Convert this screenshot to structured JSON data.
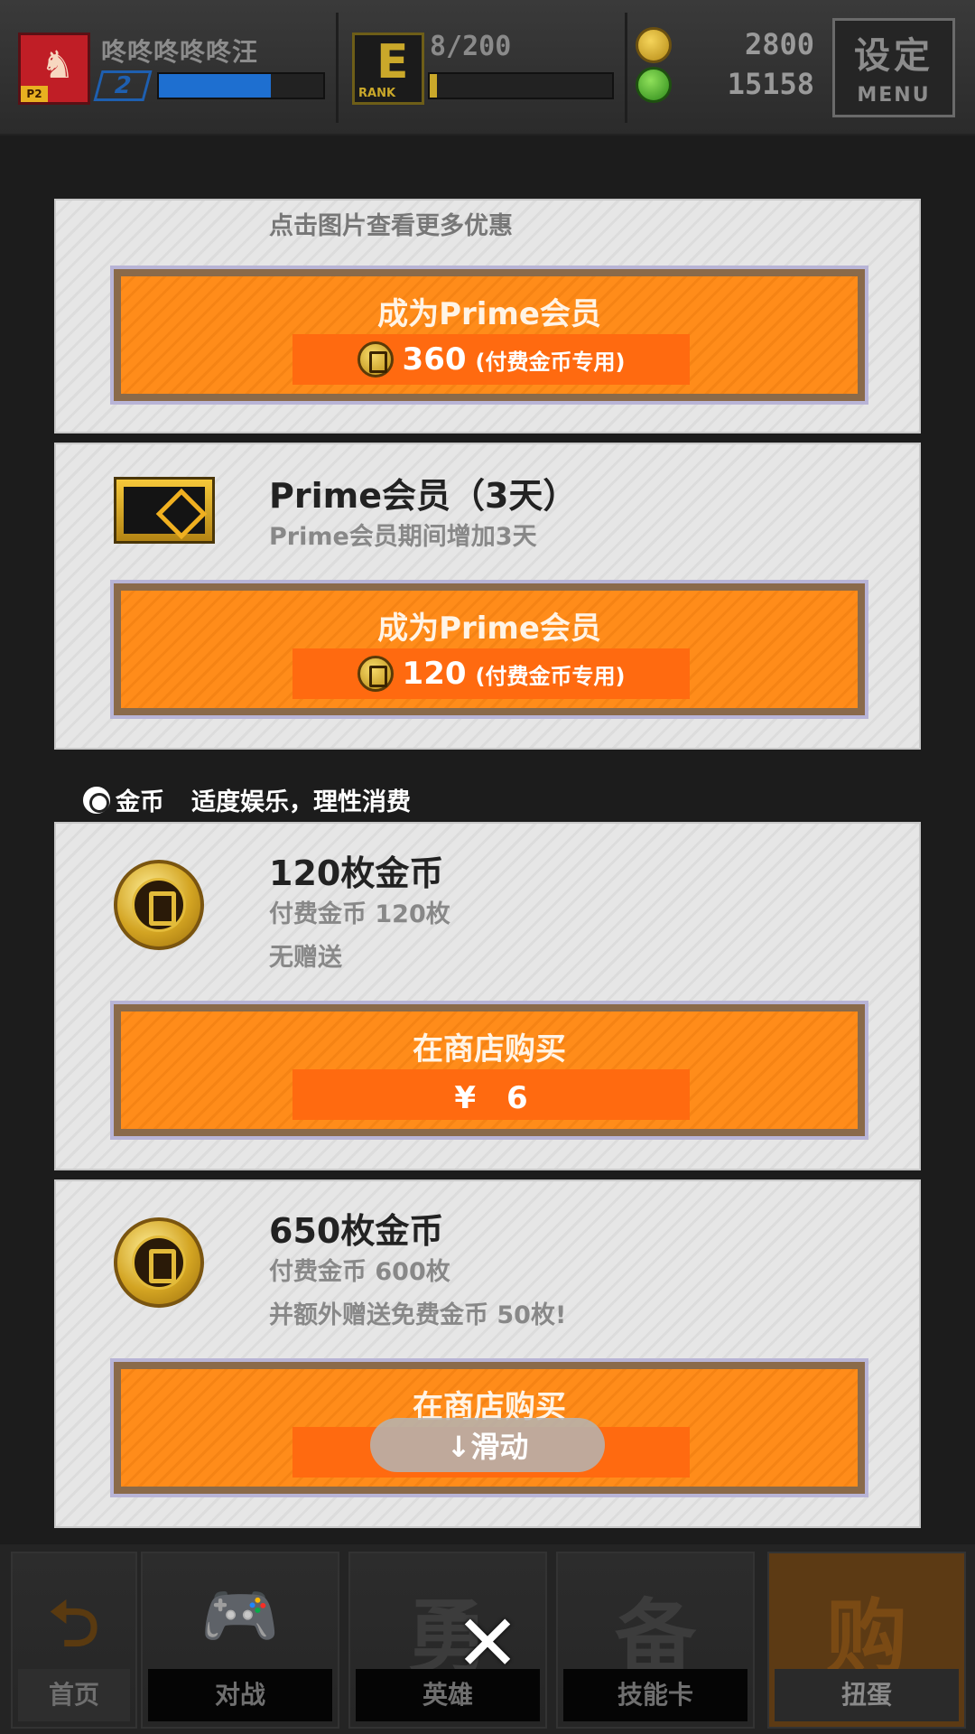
{
  "header": {
    "player_name": "咚咚咚咚咚汪",
    "player_level": "2",
    "avatar_tag": "P2",
    "rank_progress": "8/200",
    "rank_label": "RANK",
    "exp_fill": 0.68,
    "rank_fill": 0.04,
    "gold_coins": "2800",
    "green_coins": "15158",
    "menu_cn": "设定",
    "menu_en": "MENU"
  },
  "offers": [
    {
      "hint": "点击图片查看更多优惠",
      "button_label": "成为Prime会员",
      "price": "360",
      "price_note": "(付费金币专用)"
    },
    {
      "title": "Prime会员（3天）",
      "desc": "Prime会员期间增加3天",
      "icon": "prime-ticket-icon",
      "button_label": "成为Prime会员",
      "price": "120",
      "price_note": "(付费金币专用)"
    }
  ],
  "coin_section": {
    "label": "金币",
    "slogan": "适度娱乐，理性消费"
  },
  "coin_packs": [
    {
      "title": "120枚金币",
      "line1": "付费金币 120枚",
      "line2": "无赠送",
      "button_label": "在商店购买",
      "price": "¥　6"
    },
    {
      "title": "650枚金币",
      "line1": "付费金币 600枚",
      "line2": "并额外赠送免费金币 50枚!",
      "button_label": "在商店购买",
      "price": ""
    }
  ],
  "swipe_hint": "↓滑动",
  "nav": [
    {
      "label": "首页",
      "icon": "back-arrow-icon",
      "glyph": "⮌"
    },
    {
      "label": "对战",
      "icon": "gamepad-icon",
      "glyph": "🎮"
    },
    {
      "label": "英雄",
      "icon": "hero-icon",
      "glyph": "勇"
    },
    {
      "label": "技能卡",
      "icon": "skill-card-icon",
      "glyph": "备"
    },
    {
      "label": "扭蛋",
      "icon": "gacha-icon",
      "glyph": "购"
    }
  ],
  "close_glyph": "✕",
  "colors": {
    "accent_orange": "#ff8c1a",
    "price_orange": "#ff6a10",
    "exp_blue": "#1e6fd0",
    "rank_gold": "#caa82a"
  }
}
